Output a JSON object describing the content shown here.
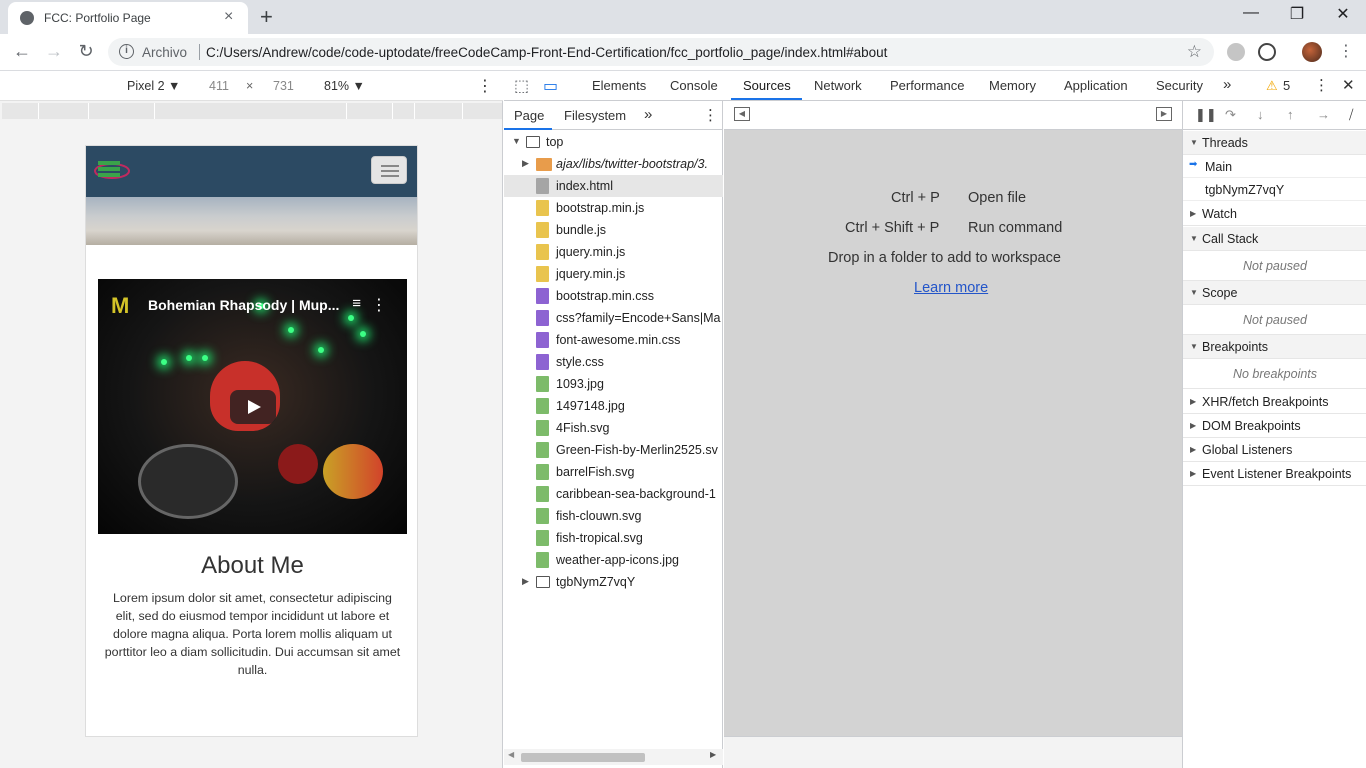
{
  "browser": {
    "tab_title": "FCC: Portfolio Page",
    "omnibox_origin": "Archivo",
    "url": "C:/Users/Andrew/code/code-uptodate/freeCodeCamp-Front-End-Certification/fcc_portfolio_page/index.html#about",
    "close_symbol": "×",
    "newtab_symbol": "+",
    "back_symbol": "←",
    "forward_symbol": "→",
    "reload_symbol": "↻",
    "star_symbol": "☆",
    "minimize_symbol": "—",
    "restore_symbol": "❐",
    "window_close_symbol": "✕"
  },
  "device_toolbar": {
    "device": "Pixel 2 ▼",
    "width": "411",
    "times": "×",
    "height": "731",
    "zoom": "81% ▼",
    "more": "⋮"
  },
  "page": {
    "video_title": "Bohemian Rhapsody | Mup...",
    "video_logo": "M",
    "video_queue_symbol": "≡",
    "video_menu_symbol": "⋮",
    "about_title": "About Me",
    "about_text": "Lorem ipsum dolor sit amet, consectetur adipiscing elit, sed do eiusmod tempor incididunt ut labore et dolore magna aliqua. Porta lorem mollis aliquam ut porttitor leo a diam sollicitudin. Dui accumsan sit amet nulla."
  },
  "devtools": {
    "tabs": [
      "Elements",
      "Console",
      "Sources",
      "Network",
      "Performance",
      "Memory",
      "Application",
      "Security"
    ],
    "active_tab": "Sources",
    "more_tabs": "»",
    "warning_count": "5",
    "warning_symbol": "⚠",
    "menu_symbol": "⋮",
    "close_symbol": "✕",
    "navigator": {
      "tabs": [
        "Page",
        "Filesystem"
      ],
      "more": "»",
      "menu": "⋮",
      "tree": [
        {
          "label": "top",
          "type": "frame",
          "depth": 0,
          "expanded": true
        },
        {
          "label": "ajax/libs/twitter-bootstrap/3.",
          "type": "folder",
          "depth": 1,
          "expanded": false
        },
        {
          "label": "index.html",
          "type": "html",
          "depth": 2,
          "selected": true
        },
        {
          "label": "bootstrap.min.js",
          "type": "js",
          "depth": 2
        },
        {
          "label": "bundle.js",
          "type": "js",
          "depth": 2
        },
        {
          "label": "jquery.min.js",
          "type": "js",
          "depth": 2
        },
        {
          "label": "jquery.min.js",
          "type": "js",
          "depth": 2
        },
        {
          "label": "bootstrap.min.css",
          "type": "css",
          "depth": 2
        },
        {
          "label": "css?family=Encode+Sans|Ma",
          "type": "css",
          "depth": 2
        },
        {
          "label": "font-awesome.min.css",
          "type": "css",
          "depth": 2
        },
        {
          "label": "style.css",
          "type": "css",
          "depth": 2
        },
        {
          "label": "1093.jpg",
          "type": "img",
          "depth": 2
        },
        {
          "label": "1497148.jpg",
          "type": "img",
          "depth": 2
        },
        {
          "label": "4Fish.svg",
          "type": "img",
          "depth": 2
        },
        {
          "label": "Green-Fish-by-Merlin2525.sv",
          "type": "img",
          "depth": 2
        },
        {
          "label": "barrelFish.svg",
          "type": "img",
          "depth": 2
        },
        {
          "label": "caribbean-sea-background-1",
          "type": "img",
          "depth": 2
        },
        {
          "label": "fish-clouwn.svg",
          "type": "img",
          "depth": 2
        },
        {
          "label": "fish-tropical.svg",
          "type": "img",
          "depth": 2
        },
        {
          "label": "weather-app-icons.jpg",
          "type": "img",
          "depth": 2
        },
        {
          "label": "tgbNymZ7vqY",
          "type": "frame",
          "depth": 1,
          "expanded": false
        }
      ]
    },
    "editor": {
      "shortcut1_keys": "Ctrl + P",
      "shortcut1_action": "Open file",
      "shortcut2_keys": "Ctrl + Shift + P",
      "shortcut2_action": "Run command",
      "drop_hint": "Drop in a folder to add to workspace",
      "learn_more": "Learn more"
    },
    "sidebar": {
      "threads_label": "Threads",
      "thread_main": "Main",
      "thread_other": "tgbNymZ7vqY",
      "watch": "Watch",
      "call_stack": "Call Stack",
      "call_stack_empty": "Not paused",
      "scope": "Scope",
      "scope_empty": "Not paused",
      "breakpoints": "Breakpoints",
      "breakpoints_empty": "No breakpoints",
      "xhr": "XHR/fetch Breakpoints",
      "dom": "DOM Breakpoints",
      "global": "Global Listeners",
      "event": "Event Listener Breakpoints"
    }
  },
  "colors": {
    "accent": "#1a73e8",
    "html_icon": "#a5a5a5",
    "js_icon": "#e9c44e",
    "css_icon": "#8d63d2",
    "img_icon": "#7dbb6a",
    "folder_icon": "#e89c4b",
    "warning": "#f2a600"
  }
}
